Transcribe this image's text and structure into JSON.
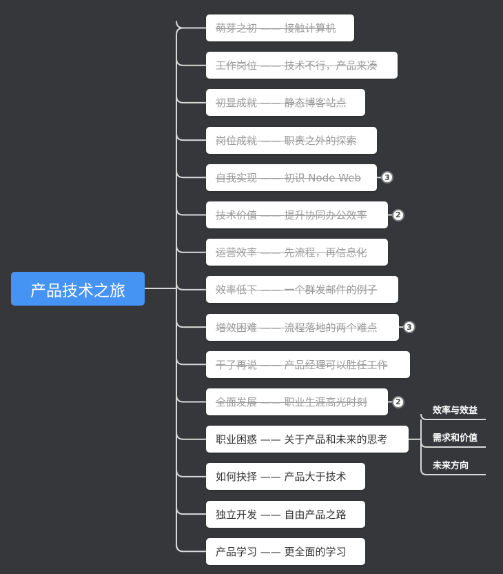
{
  "root": {
    "label": "产品技术之旅"
  },
  "branches": [
    {
      "label": "萌芽之初 —— 接触计算机",
      "done": true,
      "badge": null
    },
    {
      "label": "工作岗位 —— 技术不行，产品来凑",
      "done": true,
      "badge": null
    },
    {
      "label": "初显成就 —— 静态博客站点",
      "done": true,
      "badge": null
    },
    {
      "label": "岗位成就 —— 职责之外的探索",
      "done": true,
      "badge": null
    },
    {
      "label": "自我实现 —— 初识 Node Web",
      "done": true,
      "badge": "3"
    },
    {
      "label": "技术价值 —— 提升协同办公效率",
      "done": true,
      "badge": "2"
    },
    {
      "label": "运营效率 —— 先流程，再信息化",
      "done": true,
      "badge": null
    },
    {
      "label": "效率低下 —— 一个群发邮件的例子",
      "done": true,
      "badge": null
    },
    {
      "label": "增效困难 —— 流程落地的两个难点",
      "done": true,
      "badge": "3"
    },
    {
      "label": "干了再说 —— 产品经理可以胜任工作",
      "done": true,
      "badge": null
    },
    {
      "label": "全面发展 —— 职业生涯高光时刻",
      "done": true,
      "badge": "2"
    },
    {
      "label": "职业困惑 —— 关于产品和未来的思考",
      "done": false,
      "badge": null,
      "children": [
        "效率与效益",
        "需求和价值",
        "未来方向"
      ]
    },
    {
      "label": "如何抉择 —— 产品大于技术",
      "done": false,
      "badge": null
    },
    {
      "label": "独立开发 —— 自由产品之路",
      "done": false,
      "badge": null
    },
    {
      "label": "产品学习 —— 更全面的学习",
      "done": false,
      "badge": null
    }
  ],
  "colors": {
    "background": "#35373b",
    "root": "#4593f3",
    "line": "#d9d9d9",
    "done_text": "#9b9b9b",
    "active_text": "#333333"
  }
}
